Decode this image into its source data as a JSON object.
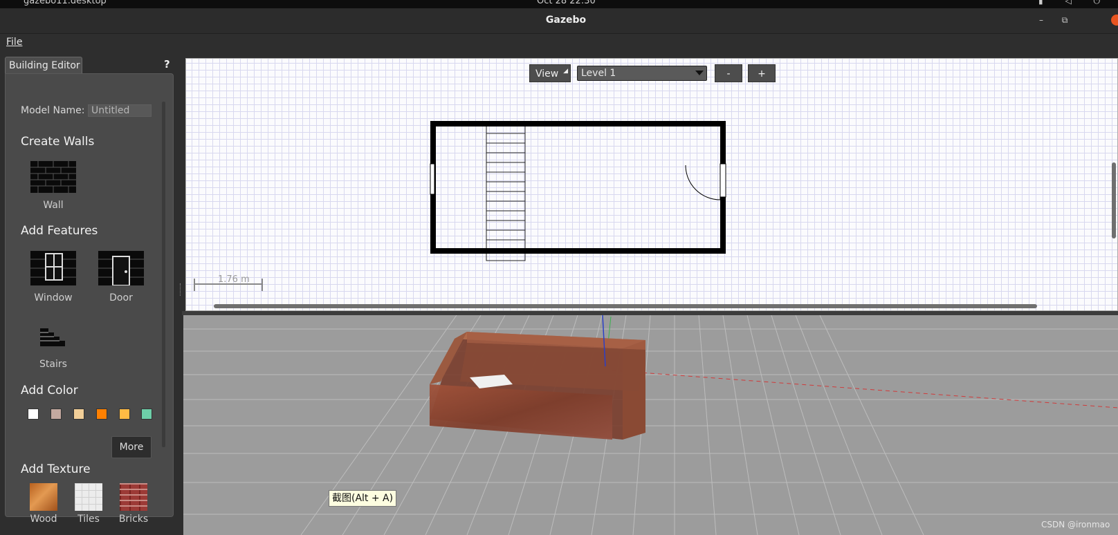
{
  "system_bar": {
    "app_name": "gazebo11.desktop",
    "clock": "Oct 28  22:30"
  },
  "window": {
    "title": "Gazebo"
  },
  "menu": {
    "file": "File"
  },
  "left_panel": {
    "tab_label": "Building Editor",
    "help": "?",
    "model_name_label": "Model Name:",
    "model_name_value": "Untitled",
    "sections": {
      "create_walls": "Create Walls",
      "add_features": "Add Features",
      "add_color": "Add Color",
      "add_texture": "Add Texture"
    },
    "tools": {
      "wall": "Wall",
      "window": "Window",
      "door": "Door",
      "stairs": "Stairs"
    },
    "colors": [
      "#ffffff",
      "#c4a9a0",
      "#f2cf98",
      "#ff8000",
      "#ffbb44",
      "#6dcfa8"
    ],
    "more_button": "More",
    "textures": {
      "wood": "Wood",
      "tiles": "Tiles",
      "bricks": "Bricks"
    }
  },
  "editor_2d": {
    "view_button": "View",
    "level_select": "Level 1",
    "remove_level": "-",
    "add_level": "+",
    "scale_label": "1.76 m"
  },
  "tooltip": "截图(Alt + A)",
  "watermark": "CSDN @ironmao"
}
